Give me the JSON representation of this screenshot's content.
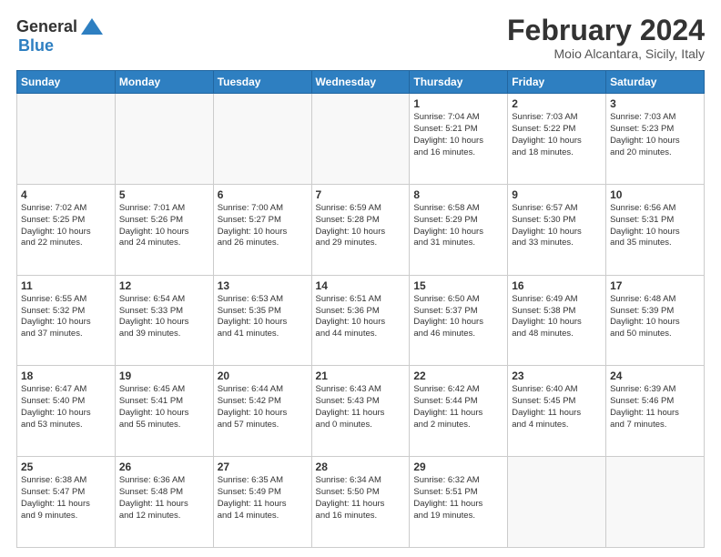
{
  "header": {
    "logo_line1": "General",
    "logo_line2": "Blue",
    "month": "February 2024",
    "location": "Moio Alcantara, Sicily, Italy"
  },
  "days_of_week": [
    "Sunday",
    "Monday",
    "Tuesday",
    "Wednesday",
    "Thursday",
    "Friday",
    "Saturday"
  ],
  "weeks": [
    [
      {
        "day": "",
        "info": ""
      },
      {
        "day": "",
        "info": ""
      },
      {
        "day": "",
        "info": ""
      },
      {
        "day": "",
        "info": ""
      },
      {
        "day": "1",
        "info": "Sunrise: 7:04 AM\nSunset: 5:21 PM\nDaylight: 10 hours\nand 16 minutes."
      },
      {
        "day": "2",
        "info": "Sunrise: 7:03 AM\nSunset: 5:22 PM\nDaylight: 10 hours\nand 18 minutes."
      },
      {
        "day": "3",
        "info": "Sunrise: 7:03 AM\nSunset: 5:23 PM\nDaylight: 10 hours\nand 20 minutes."
      }
    ],
    [
      {
        "day": "4",
        "info": "Sunrise: 7:02 AM\nSunset: 5:25 PM\nDaylight: 10 hours\nand 22 minutes."
      },
      {
        "day": "5",
        "info": "Sunrise: 7:01 AM\nSunset: 5:26 PM\nDaylight: 10 hours\nand 24 minutes."
      },
      {
        "day": "6",
        "info": "Sunrise: 7:00 AM\nSunset: 5:27 PM\nDaylight: 10 hours\nand 26 minutes."
      },
      {
        "day": "7",
        "info": "Sunrise: 6:59 AM\nSunset: 5:28 PM\nDaylight: 10 hours\nand 29 minutes."
      },
      {
        "day": "8",
        "info": "Sunrise: 6:58 AM\nSunset: 5:29 PM\nDaylight: 10 hours\nand 31 minutes."
      },
      {
        "day": "9",
        "info": "Sunrise: 6:57 AM\nSunset: 5:30 PM\nDaylight: 10 hours\nand 33 minutes."
      },
      {
        "day": "10",
        "info": "Sunrise: 6:56 AM\nSunset: 5:31 PM\nDaylight: 10 hours\nand 35 minutes."
      }
    ],
    [
      {
        "day": "11",
        "info": "Sunrise: 6:55 AM\nSunset: 5:32 PM\nDaylight: 10 hours\nand 37 minutes."
      },
      {
        "day": "12",
        "info": "Sunrise: 6:54 AM\nSunset: 5:33 PM\nDaylight: 10 hours\nand 39 minutes."
      },
      {
        "day": "13",
        "info": "Sunrise: 6:53 AM\nSunset: 5:35 PM\nDaylight: 10 hours\nand 41 minutes."
      },
      {
        "day": "14",
        "info": "Sunrise: 6:51 AM\nSunset: 5:36 PM\nDaylight: 10 hours\nand 44 minutes."
      },
      {
        "day": "15",
        "info": "Sunrise: 6:50 AM\nSunset: 5:37 PM\nDaylight: 10 hours\nand 46 minutes."
      },
      {
        "day": "16",
        "info": "Sunrise: 6:49 AM\nSunset: 5:38 PM\nDaylight: 10 hours\nand 48 minutes."
      },
      {
        "day": "17",
        "info": "Sunrise: 6:48 AM\nSunset: 5:39 PM\nDaylight: 10 hours\nand 50 minutes."
      }
    ],
    [
      {
        "day": "18",
        "info": "Sunrise: 6:47 AM\nSunset: 5:40 PM\nDaylight: 10 hours\nand 53 minutes."
      },
      {
        "day": "19",
        "info": "Sunrise: 6:45 AM\nSunset: 5:41 PM\nDaylight: 10 hours\nand 55 minutes."
      },
      {
        "day": "20",
        "info": "Sunrise: 6:44 AM\nSunset: 5:42 PM\nDaylight: 10 hours\nand 57 minutes."
      },
      {
        "day": "21",
        "info": "Sunrise: 6:43 AM\nSunset: 5:43 PM\nDaylight: 11 hours\nand 0 minutes."
      },
      {
        "day": "22",
        "info": "Sunrise: 6:42 AM\nSunset: 5:44 PM\nDaylight: 11 hours\nand 2 minutes."
      },
      {
        "day": "23",
        "info": "Sunrise: 6:40 AM\nSunset: 5:45 PM\nDaylight: 11 hours\nand 4 minutes."
      },
      {
        "day": "24",
        "info": "Sunrise: 6:39 AM\nSunset: 5:46 PM\nDaylight: 11 hours\nand 7 minutes."
      }
    ],
    [
      {
        "day": "25",
        "info": "Sunrise: 6:38 AM\nSunset: 5:47 PM\nDaylight: 11 hours\nand 9 minutes."
      },
      {
        "day": "26",
        "info": "Sunrise: 6:36 AM\nSunset: 5:48 PM\nDaylight: 11 hours\nand 12 minutes."
      },
      {
        "day": "27",
        "info": "Sunrise: 6:35 AM\nSunset: 5:49 PM\nDaylight: 11 hours\nand 14 minutes."
      },
      {
        "day": "28",
        "info": "Sunrise: 6:34 AM\nSunset: 5:50 PM\nDaylight: 11 hours\nand 16 minutes."
      },
      {
        "day": "29",
        "info": "Sunrise: 6:32 AM\nSunset: 5:51 PM\nDaylight: 11 hours\nand 19 minutes."
      },
      {
        "day": "",
        "info": ""
      },
      {
        "day": "",
        "info": ""
      }
    ]
  ]
}
